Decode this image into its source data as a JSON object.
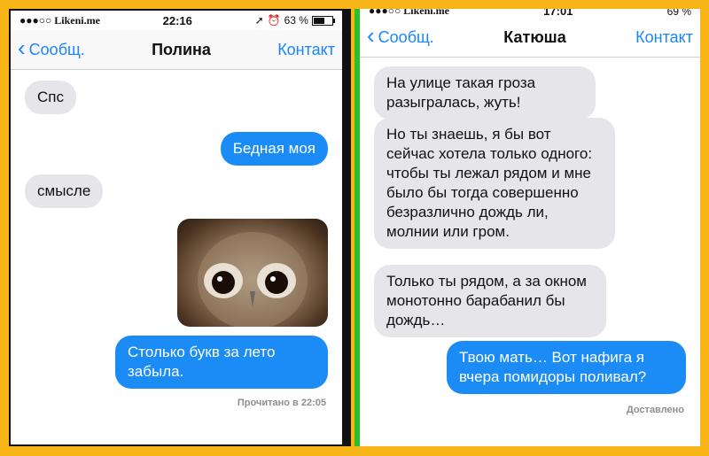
{
  "left": {
    "status": {
      "carrier": "●●●○○ Likeni.me",
      "time": "22:16",
      "battery": "63 %",
      "battery_level": 0.63
    },
    "nav": {
      "back": "Сообщ.",
      "title": "Полина",
      "right": "Контакт"
    },
    "messages": [
      {
        "dir": "in",
        "text": "Спс"
      },
      {
        "dir": "out",
        "text": "Бедная моя"
      },
      {
        "dir": "in",
        "text": "смысле"
      },
      {
        "dir": "out",
        "type": "image",
        "image": "owl-photo"
      },
      {
        "dir": "out",
        "text": "Столько букв за лето забыла."
      }
    ],
    "receipt": "Прочитано в 22:05"
  },
  "right": {
    "status": {
      "carrier": "●●●○○ Likeni.me",
      "time": "17:01",
      "battery": "69 %",
      "battery_level": 0.69
    },
    "nav": {
      "back": "Сообщ.",
      "title": "Катюша",
      "right": "Контакт"
    },
    "messages": [
      {
        "dir": "in",
        "text": "На улице такая гроза разыгралась, жуть!"
      },
      {
        "dir": "in",
        "text": "Но ты знаешь, я бы вот сейчас хотела только одного: чтобы ты лежал рядом и мне было бы тогда совершенно безразлично дождь ли, молнии или гром."
      },
      {
        "dir": "in",
        "text": "Только ты рядом, а за окном монотонно барабанил бы дождь…"
      },
      {
        "dir": "out",
        "text": "Твою мать… Вот нафига я вчера помидоры поливал?"
      }
    ],
    "receipt": "Доставлено"
  },
  "colors": {
    "frame": "#f7b517",
    "sent_bubble": "#1b8cf6",
    "received_bubble": "#e6e6ea",
    "link": "#1a85ff"
  }
}
